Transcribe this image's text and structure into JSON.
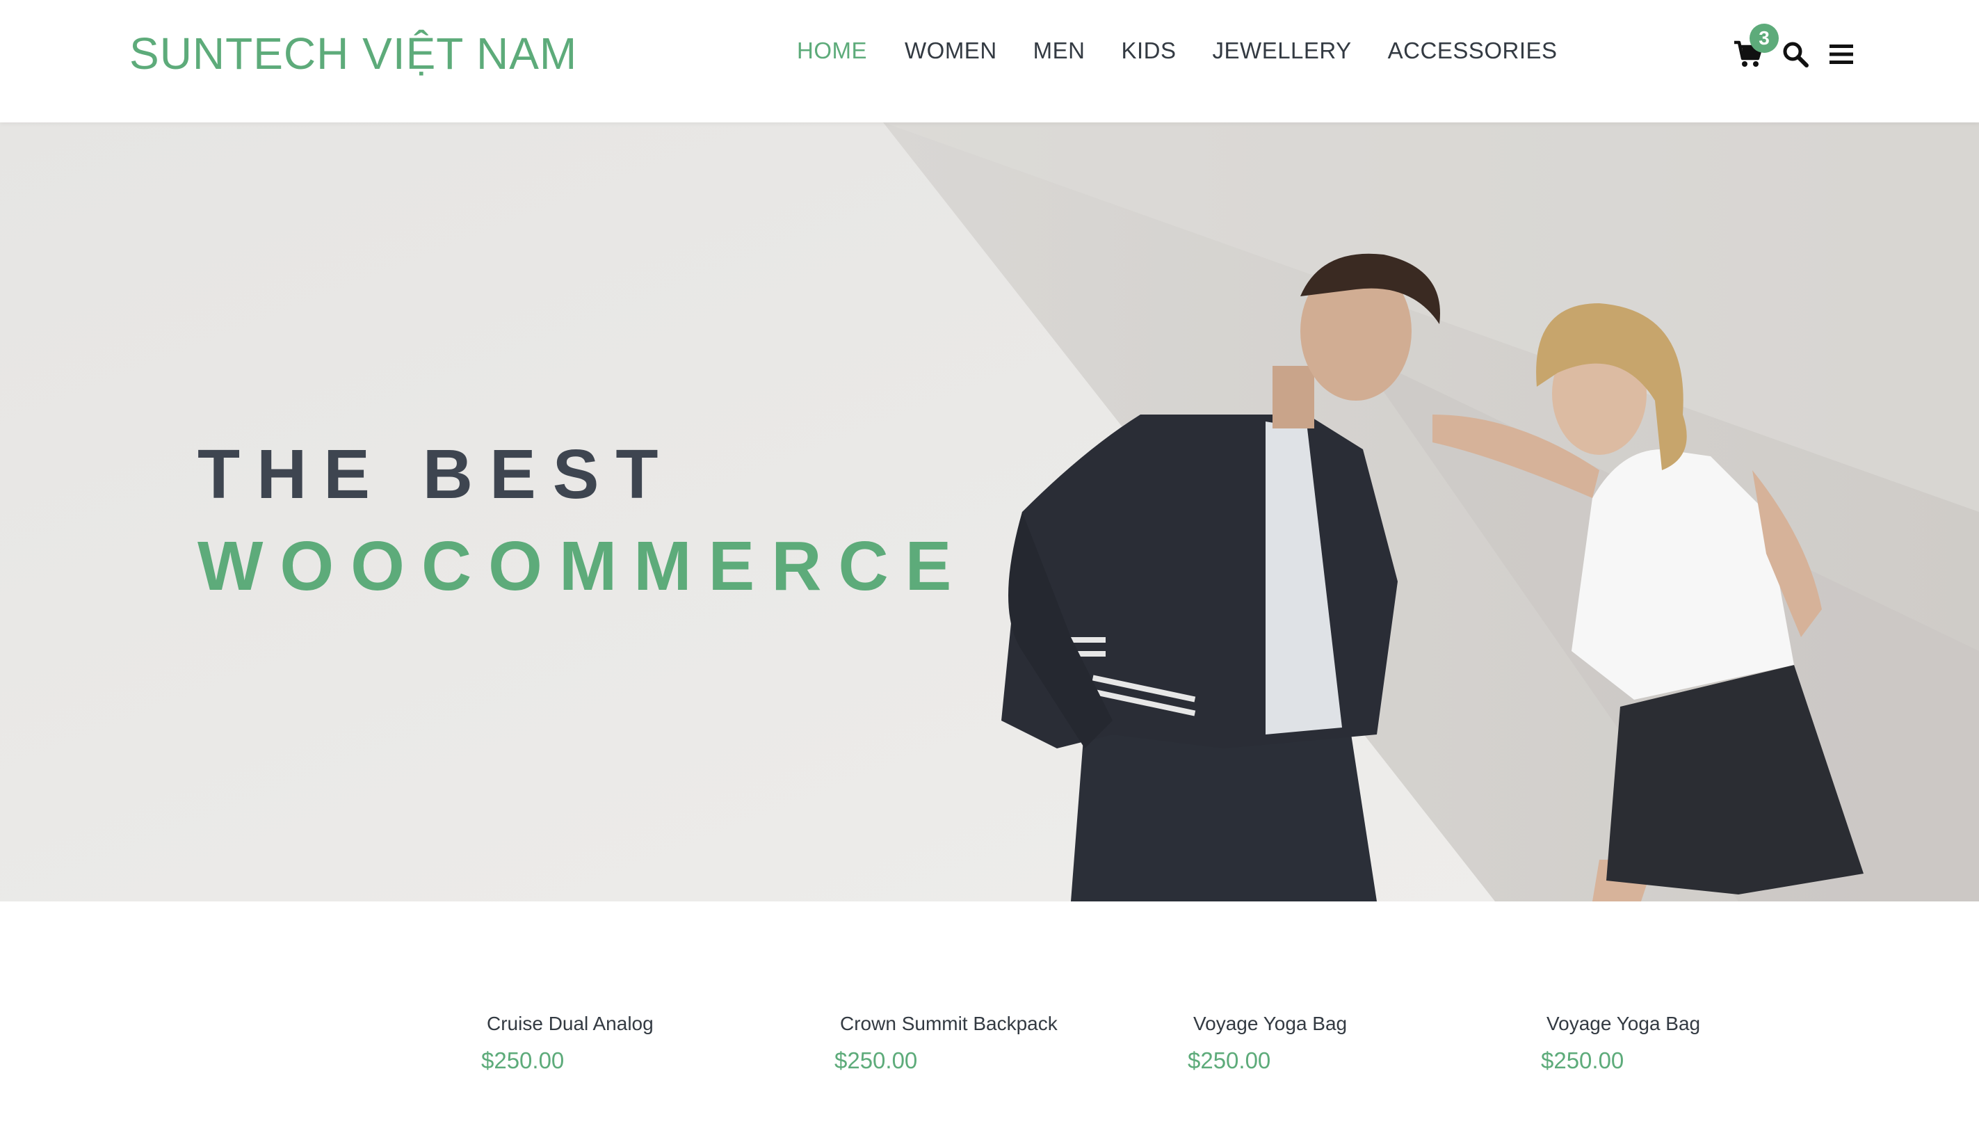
{
  "header": {
    "logo": "SUNTECH VIỆT NAM",
    "nav": [
      {
        "label": "HOME",
        "active": true
      },
      {
        "label": "WOMEN",
        "active": false
      },
      {
        "label": "MEN",
        "active": false
      },
      {
        "label": "KIDS",
        "active": false
      },
      {
        "label": "JEWELLERY",
        "active": false
      },
      {
        "label": "ACCESSORIES",
        "active": false
      }
    ],
    "cart_count": "3",
    "icons": [
      "cart-icon",
      "search-icon",
      "menu-icon"
    ]
  },
  "hero": {
    "line1": "THE BEST",
    "line2": "WOOCOMMERCE"
  },
  "products": [
    {
      "name": "Cruise Dual Analog",
      "price": "$250.00"
    },
    {
      "name": "Crown Summit Backpack",
      "price": "$250.00"
    },
    {
      "name": "Voyage Yoga Bag",
      "price": "$250.00"
    },
    {
      "name": "Voyage Yoga Bag",
      "price": "$250.00"
    }
  ],
  "colors": {
    "accent": "#5dab7a",
    "text_dark": "#333a42",
    "hero_bg": "#ecebea"
  }
}
